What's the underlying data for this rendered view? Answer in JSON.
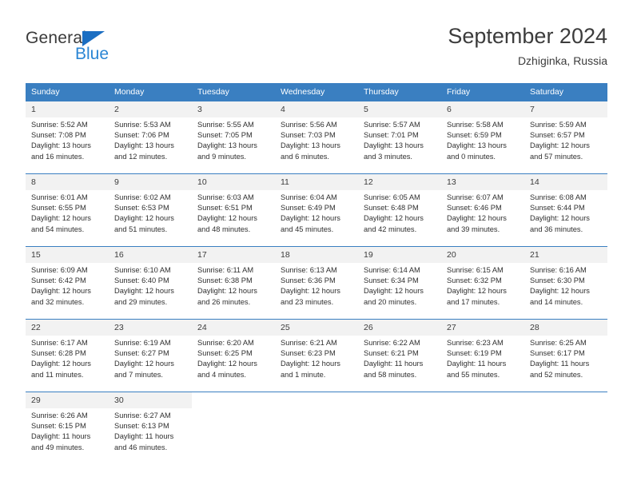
{
  "brand": {
    "line1": "General",
    "line2": "Blue",
    "triangle_color": "#1b6ec2",
    "blue_color": "#2b86d4"
  },
  "header": {
    "title": "September 2024",
    "subtitle": "Dzhiginka, Russia"
  },
  "theme": {
    "header_blue": "#3a7fc1",
    "daynum_bg": "#f2f2f2"
  },
  "weekday_headers": [
    "Sunday",
    "Monday",
    "Tuesday",
    "Wednesday",
    "Thursday",
    "Friday",
    "Saturday"
  ],
  "weeks": [
    [
      {
        "day": "1",
        "sunrise": "Sunrise: 5:52 AM",
        "sunset": "Sunset: 7:08 PM",
        "daylight1": "Daylight: 13 hours",
        "daylight2": "and 16 minutes."
      },
      {
        "day": "2",
        "sunrise": "Sunrise: 5:53 AM",
        "sunset": "Sunset: 7:06 PM",
        "daylight1": "Daylight: 13 hours",
        "daylight2": "and 12 minutes."
      },
      {
        "day": "3",
        "sunrise": "Sunrise: 5:55 AM",
        "sunset": "Sunset: 7:05 PM",
        "daylight1": "Daylight: 13 hours",
        "daylight2": "and 9 minutes."
      },
      {
        "day": "4",
        "sunrise": "Sunrise: 5:56 AM",
        "sunset": "Sunset: 7:03 PM",
        "daylight1": "Daylight: 13 hours",
        "daylight2": "and 6 minutes."
      },
      {
        "day": "5",
        "sunrise": "Sunrise: 5:57 AM",
        "sunset": "Sunset: 7:01 PM",
        "daylight1": "Daylight: 13 hours",
        "daylight2": "and 3 minutes."
      },
      {
        "day": "6",
        "sunrise": "Sunrise: 5:58 AM",
        "sunset": "Sunset: 6:59 PM",
        "daylight1": "Daylight: 13 hours",
        "daylight2": "and 0 minutes."
      },
      {
        "day": "7",
        "sunrise": "Sunrise: 5:59 AM",
        "sunset": "Sunset: 6:57 PM",
        "daylight1": "Daylight: 12 hours",
        "daylight2": "and 57 minutes."
      }
    ],
    [
      {
        "day": "8",
        "sunrise": "Sunrise: 6:01 AM",
        "sunset": "Sunset: 6:55 PM",
        "daylight1": "Daylight: 12 hours",
        "daylight2": "and 54 minutes."
      },
      {
        "day": "9",
        "sunrise": "Sunrise: 6:02 AM",
        "sunset": "Sunset: 6:53 PM",
        "daylight1": "Daylight: 12 hours",
        "daylight2": "and 51 minutes."
      },
      {
        "day": "10",
        "sunrise": "Sunrise: 6:03 AM",
        "sunset": "Sunset: 6:51 PM",
        "daylight1": "Daylight: 12 hours",
        "daylight2": "and 48 minutes."
      },
      {
        "day": "11",
        "sunrise": "Sunrise: 6:04 AM",
        "sunset": "Sunset: 6:49 PM",
        "daylight1": "Daylight: 12 hours",
        "daylight2": "and 45 minutes."
      },
      {
        "day": "12",
        "sunrise": "Sunrise: 6:05 AM",
        "sunset": "Sunset: 6:48 PM",
        "daylight1": "Daylight: 12 hours",
        "daylight2": "and 42 minutes."
      },
      {
        "day": "13",
        "sunrise": "Sunrise: 6:07 AM",
        "sunset": "Sunset: 6:46 PM",
        "daylight1": "Daylight: 12 hours",
        "daylight2": "and 39 minutes."
      },
      {
        "day": "14",
        "sunrise": "Sunrise: 6:08 AM",
        "sunset": "Sunset: 6:44 PM",
        "daylight1": "Daylight: 12 hours",
        "daylight2": "and 36 minutes."
      }
    ],
    [
      {
        "day": "15",
        "sunrise": "Sunrise: 6:09 AM",
        "sunset": "Sunset: 6:42 PM",
        "daylight1": "Daylight: 12 hours",
        "daylight2": "and 32 minutes."
      },
      {
        "day": "16",
        "sunrise": "Sunrise: 6:10 AM",
        "sunset": "Sunset: 6:40 PM",
        "daylight1": "Daylight: 12 hours",
        "daylight2": "and 29 minutes."
      },
      {
        "day": "17",
        "sunrise": "Sunrise: 6:11 AM",
        "sunset": "Sunset: 6:38 PM",
        "daylight1": "Daylight: 12 hours",
        "daylight2": "and 26 minutes."
      },
      {
        "day": "18",
        "sunrise": "Sunrise: 6:13 AM",
        "sunset": "Sunset: 6:36 PM",
        "daylight1": "Daylight: 12 hours",
        "daylight2": "and 23 minutes."
      },
      {
        "day": "19",
        "sunrise": "Sunrise: 6:14 AM",
        "sunset": "Sunset: 6:34 PM",
        "daylight1": "Daylight: 12 hours",
        "daylight2": "and 20 minutes."
      },
      {
        "day": "20",
        "sunrise": "Sunrise: 6:15 AM",
        "sunset": "Sunset: 6:32 PM",
        "daylight1": "Daylight: 12 hours",
        "daylight2": "and 17 minutes."
      },
      {
        "day": "21",
        "sunrise": "Sunrise: 6:16 AM",
        "sunset": "Sunset: 6:30 PM",
        "daylight1": "Daylight: 12 hours",
        "daylight2": "and 14 minutes."
      }
    ],
    [
      {
        "day": "22",
        "sunrise": "Sunrise: 6:17 AM",
        "sunset": "Sunset: 6:28 PM",
        "daylight1": "Daylight: 12 hours",
        "daylight2": "and 11 minutes."
      },
      {
        "day": "23",
        "sunrise": "Sunrise: 6:19 AM",
        "sunset": "Sunset: 6:27 PM",
        "daylight1": "Daylight: 12 hours",
        "daylight2": "and 7 minutes."
      },
      {
        "day": "24",
        "sunrise": "Sunrise: 6:20 AM",
        "sunset": "Sunset: 6:25 PM",
        "daylight1": "Daylight: 12 hours",
        "daylight2": "and 4 minutes."
      },
      {
        "day": "25",
        "sunrise": "Sunrise: 6:21 AM",
        "sunset": "Sunset: 6:23 PM",
        "daylight1": "Daylight: 12 hours",
        "daylight2": "and 1 minute."
      },
      {
        "day": "26",
        "sunrise": "Sunrise: 6:22 AM",
        "sunset": "Sunset: 6:21 PM",
        "daylight1": "Daylight: 11 hours",
        "daylight2": "and 58 minutes."
      },
      {
        "day": "27",
        "sunrise": "Sunrise: 6:23 AM",
        "sunset": "Sunset: 6:19 PM",
        "daylight1": "Daylight: 11 hours",
        "daylight2": "and 55 minutes."
      },
      {
        "day": "28",
        "sunrise": "Sunrise: 6:25 AM",
        "sunset": "Sunset: 6:17 PM",
        "daylight1": "Daylight: 11 hours",
        "daylight2": "and 52 minutes."
      }
    ],
    [
      {
        "day": "29",
        "sunrise": "Sunrise: 6:26 AM",
        "sunset": "Sunset: 6:15 PM",
        "daylight1": "Daylight: 11 hours",
        "daylight2": "and 49 minutes."
      },
      {
        "day": "30",
        "sunrise": "Sunrise: 6:27 AM",
        "sunset": "Sunset: 6:13 PM",
        "daylight1": "Daylight: 11 hours",
        "daylight2": "and 46 minutes."
      },
      {
        "day": "",
        "sunrise": "",
        "sunset": "",
        "daylight1": "",
        "daylight2": ""
      },
      {
        "day": "",
        "sunrise": "",
        "sunset": "",
        "daylight1": "",
        "daylight2": ""
      },
      {
        "day": "",
        "sunrise": "",
        "sunset": "",
        "daylight1": "",
        "daylight2": ""
      },
      {
        "day": "",
        "sunrise": "",
        "sunset": "",
        "daylight1": "",
        "daylight2": ""
      },
      {
        "day": "",
        "sunrise": "",
        "sunset": "",
        "daylight1": "",
        "daylight2": ""
      }
    ]
  ]
}
